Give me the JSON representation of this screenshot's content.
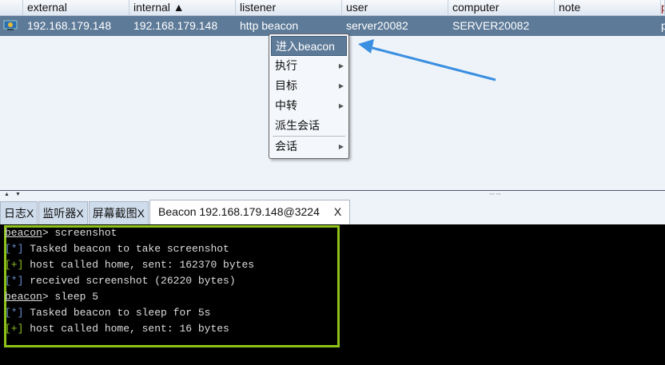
{
  "table": {
    "columns": [
      {
        "label": "",
        "w": 29
      },
      {
        "label": "external",
        "w": 133
      },
      {
        "label": "internal ▲",
        "w": 133
      },
      {
        "label": "listener",
        "w": 133
      },
      {
        "label": "user",
        "w": 133
      },
      {
        "label": "computer",
        "w": 133
      },
      {
        "label": "note",
        "w": 133
      },
      {
        "label": "p",
        "w": 5
      }
    ],
    "row": {
      "external": "192.168.179.148",
      "internal": "192.168.179.148",
      "listener": "http beacon",
      "user": "server20082",
      "computer": "SERVER20082",
      "note": "",
      "pid": "p"
    }
  },
  "menu": {
    "items": [
      "进入beacon",
      "执行",
      "目标",
      "中转",
      "派生会话",
      "会话"
    ]
  },
  "tabs": [
    {
      "label": "日志X"
    },
    {
      "label": "监听器X"
    },
    {
      "label": "屏幕截图X"
    },
    {
      "label": "Beacon 192.168.179.148@3224",
      "close": "X"
    }
  ],
  "console": {
    "prompt": "beacon",
    "lines": [
      {
        "type": "prompt",
        "text": "> screenshot"
      },
      {
        "type": "info",
        "tag": "[*]",
        "text": " Tasked beacon to take screenshot"
      },
      {
        "type": "ok",
        "tag": "[+]",
        "text": " host called home, sent: 162370 bytes"
      },
      {
        "type": "info",
        "tag": "[*]",
        "text": " received screenshot (26220 bytes)"
      },
      {
        "type": "prompt",
        "text": "> sleep 5"
      },
      {
        "type": "info",
        "tag": "[*]",
        "text": " Tasked beacon to sleep for 5s"
      },
      {
        "type": "ok",
        "tag": "[+]",
        "text": " host called home, sent: 16 bytes"
      }
    ]
  },
  "colors": {
    "selected": "#5d7a98",
    "highlight": "#8cc21a",
    "arrow": "#3b8fe0"
  }
}
